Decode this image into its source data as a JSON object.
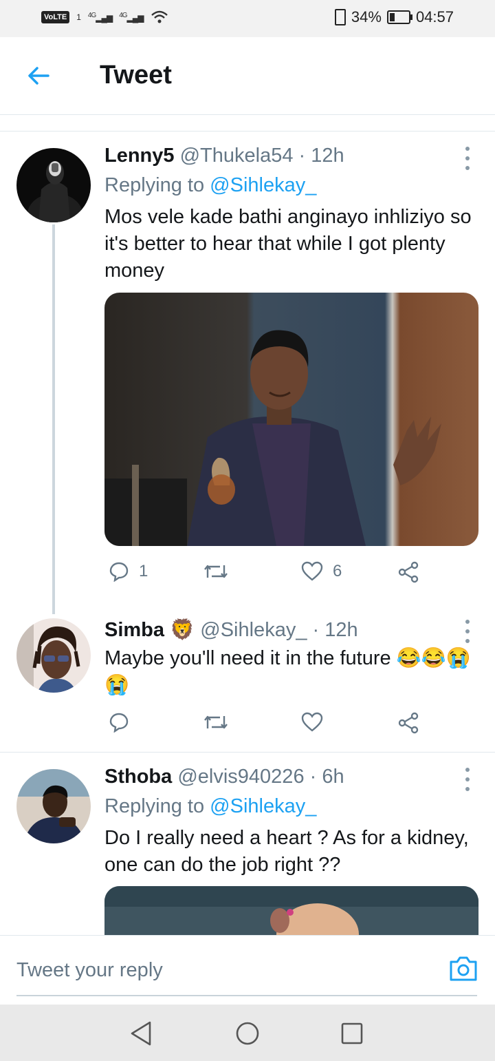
{
  "status_bar": {
    "volte": "VoLTE",
    "sim1": "1",
    "net1": "4G",
    "net2": "4G",
    "battery": "34%",
    "battery_level": 0.34,
    "time": "04:57"
  },
  "header": {
    "title": "Tweet"
  },
  "tweets": [
    {
      "name": "Lenny5",
      "handle": "@Thukela54",
      "time": "· 12h",
      "replying_label": "Replying to",
      "replying_to": "@Sihlekay_",
      "text": "Mos vele kade bathi anginayo inhliziyo so it's better to hear that while I got plenty money",
      "reply_count": "1",
      "like_count": "6"
    },
    {
      "name": "Simba",
      "emoji": "🦁",
      "handle": "@Sihlekay_",
      "time": "· 12h",
      "text": "Maybe you'll need it in the future 😂😂😭😭"
    },
    {
      "name": "Sthoba",
      "handle": "@elvis940226",
      "time": "· 6h",
      "replying_label": "Replying to",
      "replying_to": "@Sihlekay_",
      "text": "Do I really need a heart ? As for a kidney,  one can do the job right ??"
    }
  ],
  "composer": {
    "placeholder": "Tweet your reply"
  },
  "colors": {
    "accent": "#1da1f2",
    "muted": "#657786",
    "text": "#14171a"
  }
}
